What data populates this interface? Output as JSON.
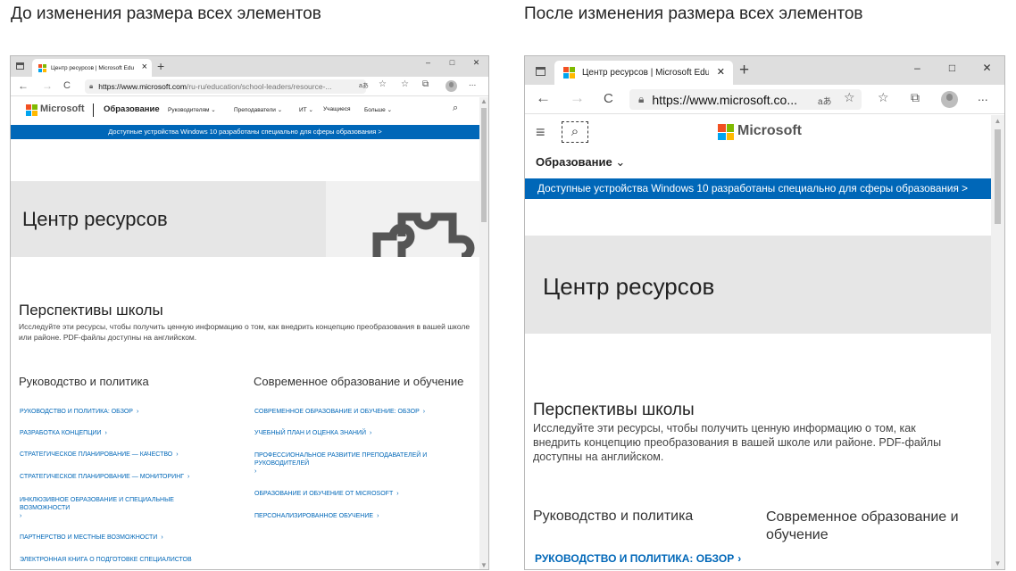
{
  "captions": {
    "before": "До изменения размера всех элементов",
    "after": "После изменения размера всех элементов"
  },
  "colors": {
    "banner": "#0067b8",
    "link": "#0067b8",
    "hero_bg": "#e6e6e6",
    "tabbar_bg": "#dedede"
  },
  "before": {
    "tab": {
      "title": "Центр ресурсов | Microsoft Edu",
      "close": "×"
    },
    "new_tab": "+",
    "window_controls": [
      "–",
      "□",
      "✕"
    ],
    "toolbar": {
      "back": "←",
      "refresh": "C",
      "url_host": "https://www.microsoft.com",
      "url_path": "/ru-ru/education/school-leaders/resource-...",
      "read_aloud": "aあ",
      "more": "..."
    },
    "nav": {
      "brand": "Microsoft",
      "section": "Образование",
      "items": [
        "Руководителям",
        "Преподаватели",
        "ИТ",
        "Учащиеся",
        "Больше"
      ]
    },
    "banner": "Доступные устройства Windows 10 разработаны специально для сферы образования >",
    "hero_title": "Центр ресурсов",
    "section_title": "Перспективы школы",
    "section_desc": "Исследуйте эти ресурсы, чтобы получить ценную информацию о том, как внедрить концепцию преобразования в вашей школе или районе. PDF-файлы доступны на английском.",
    "col1": {
      "heading": "Руководство и политика",
      "links": [
        "Руководство и политика: обзор",
        "Разработка концепции",
        "Стратегическое планирование — качество",
        "Стратегическое планирование — мониторинг",
        "Инклюзивное образование и специальные возможности",
        "Партнерство и местные возможности",
        "Электронная книга о подготовке специалистов"
      ]
    },
    "col2": {
      "heading": "Современное образование и обучение",
      "links": [
        "Современное образование и обучение: обзор",
        "Учебный план и оценка знаний",
        "Профессиональное развитие преподавателей и руководителей",
        "Образование и обучение от Microsoft",
        "Персонализированное обучение"
      ]
    }
  },
  "after": {
    "tab": {
      "title": "Центр ресурсов | Microsoft Edu",
      "close": "✕"
    },
    "new_tab": "+",
    "window_controls": [
      "–",
      "□",
      "✕"
    ],
    "toolbar": {
      "back": "←",
      "forward": "→",
      "refresh": "C",
      "url": "https://www.microsoft.co...",
      "read_aloud": "aあ",
      "more": "..."
    },
    "nav": {
      "brand": "Microsoft",
      "section": "Образование",
      "menu": "≡"
    },
    "banner": "Доступные устройства Windows 10 разработаны специально для сферы образования >",
    "hero_title": "Центр ресурсов",
    "section_title": "Перспективы школы",
    "section_desc": "Исследуйте эти ресурсы, чтобы получить ценную информацию о том, как внедрить концепцию преобразования в вашей школе или районе. PDF-файлы доступны на английском.",
    "col1_heading": "Руководство и политика",
    "col2_heading": "Современное образование и обучение",
    "first_link": "Руководство и политика: обзор"
  }
}
